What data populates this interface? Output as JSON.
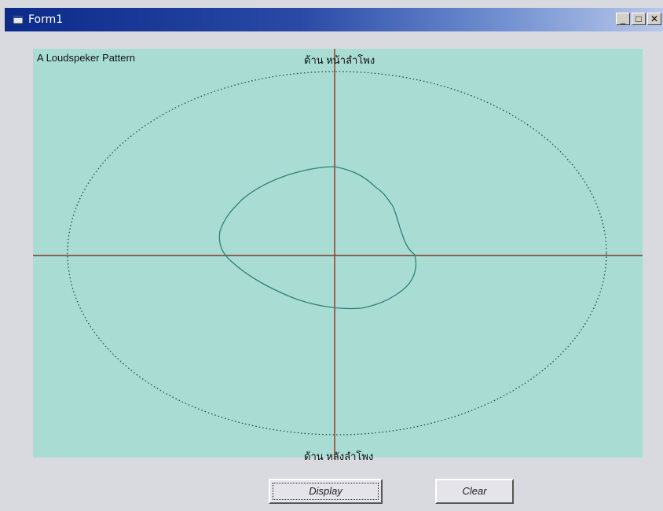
{
  "window": {
    "title": "Form1",
    "minimize_glyph": "_",
    "maximize_glyph": "□",
    "close_glyph": "✕"
  },
  "canvas": {
    "caption": "A Loudspeker Pattern",
    "top_label": "ด้าน  หน้าลำโพง",
    "bottom_label": "ด้าน  หลังลำโพง",
    "background": "#a9ddd3",
    "axis_color": "#7a3b2a",
    "ellipse_color": "#1f4a3a",
    "pattern_color": "#2f7f7a"
  },
  "buttons": {
    "display": "Display",
    "clear": "Clear"
  }
}
